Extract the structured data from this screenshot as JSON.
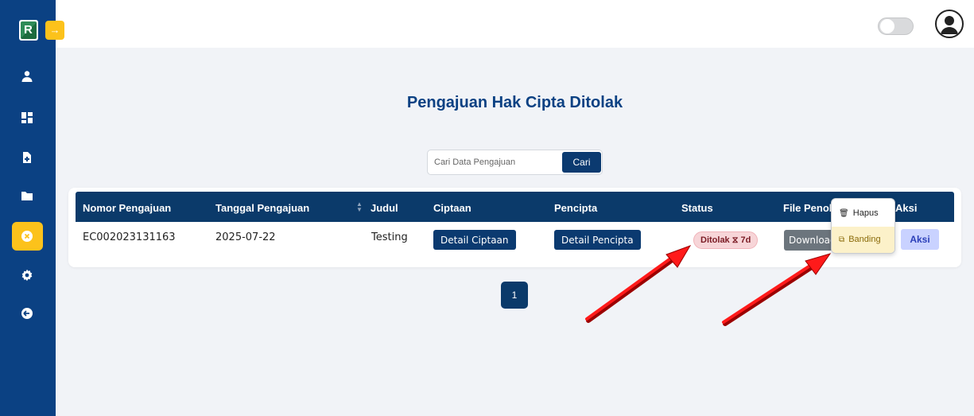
{
  "app": {
    "logo_glyph": "R",
    "collapse_icon": "→"
  },
  "sidebar": {
    "items": [
      {
        "name": "user-icon"
      },
      {
        "name": "dashboard-icon"
      },
      {
        "name": "file-add-icon"
      },
      {
        "name": "folder-icon"
      },
      {
        "name": "rejected-icon",
        "active": true
      },
      {
        "name": "gear-icon"
      },
      {
        "name": "logout-icon"
      }
    ],
    "active_color": "#fcc21b",
    "bg_color": "#0b4183"
  },
  "topbar": {
    "theme_toggle": "off"
  },
  "main": {
    "title": "Pengajuan Hak Cipta Ditolak",
    "search": {
      "placeholder": "Cari Data Pengajuan",
      "value": "",
      "button_label": "Cari"
    },
    "table": {
      "headers": [
        "Nomor Pengajuan",
        "Tanggal Pengajuan",
        "Judul",
        "Ciptaan",
        "Pencipta",
        "Status",
        "File Penol",
        "Aksi"
      ],
      "rows": [
        {
          "nomor": "EC002023131163",
          "tanggal": "2025-07-22",
          "judul": "Testing",
          "ciptaan_button": "Detail Ciptaan",
          "pencipta_button": "Detail Pencipta",
          "status": "Ditolak ⧖ 7d",
          "file_button": "Download",
          "aksi_button": "Aksi"
        }
      ]
    },
    "dropdown": {
      "items": [
        {
          "icon": "🗑",
          "label": "Hapus"
        },
        {
          "icon": "⧉",
          "label": "Banding"
        }
      ]
    },
    "pagination": {
      "current_page": "1"
    }
  },
  "colors": {
    "primary": "#0b3a6a",
    "status_rejected_bg": "#f7d5d8",
    "accent": "#fcc21b"
  }
}
